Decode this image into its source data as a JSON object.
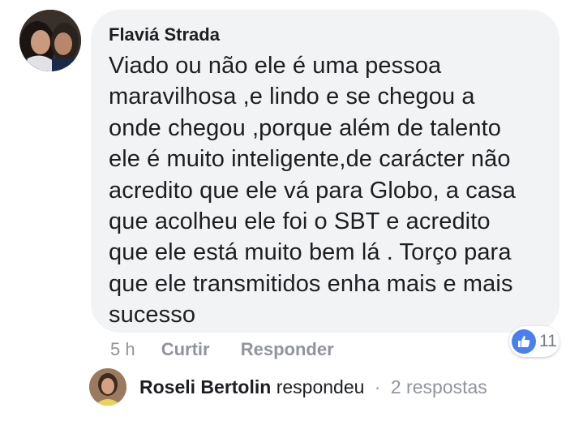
{
  "comment": {
    "author": "Flaviá Strada",
    "text": "Viado ou não ele é uma  pessoa\nmaravilhosa ,e lindo e se chegou a\nonde chegou ,porque além de talento\nele é muito inteligente,de carácter não\nacredito que ele vá para Globo, a casa\nque acolheu ele foi o SBT e acredito\nque ele está muito bem lá . Torço para\nque ele transmitidos enha mais e mais\nsucesso",
    "time": "5 h",
    "like_label": "Curtir",
    "reply_label": "Responder",
    "reactions": {
      "icon": "thumbs-up-icon",
      "count": "11",
      "color": "#4a7ff0"
    }
  },
  "reply": {
    "author": "Roseli Bertolin",
    "action": "respondeu",
    "separator": "·",
    "count": "2 respostas"
  },
  "colors": {
    "bubble": "#f2f3f5",
    "text": "#1c1e21",
    "muted": "#90949c"
  }
}
